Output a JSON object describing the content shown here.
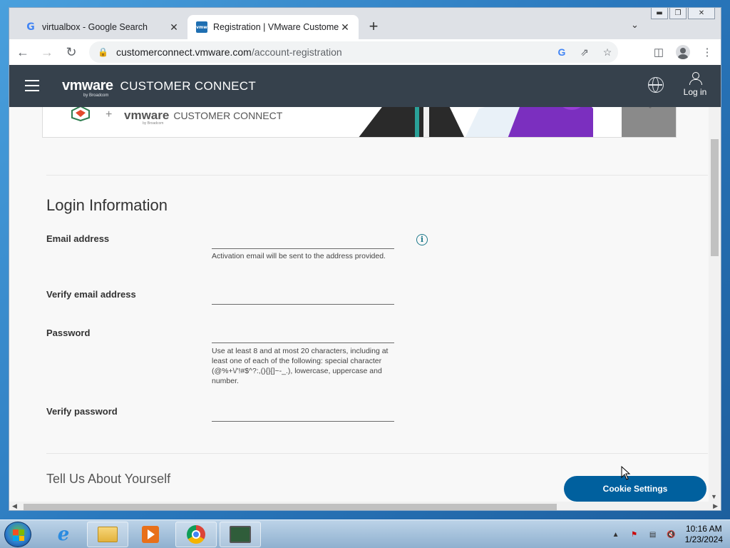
{
  "browser": {
    "tabs": [
      {
        "title": "virtualbox - Google Search",
        "active": false
      },
      {
        "title": "Registration | VMware Customer",
        "active": true
      }
    ],
    "url_host": "customerconnect.vmware.com",
    "url_path": "/account-registration"
  },
  "site": {
    "brand_logo": "vmware",
    "brand_by": "by Broadcom",
    "brand_name": "CUSTOMER CONNECT",
    "login_label": "Log in"
  },
  "banner": {
    "brand_logo": "vmware",
    "brand_name": "CUSTOMER CONNECT",
    "brand_by": "by Broadcom",
    "plus": "+"
  },
  "form": {
    "section_title": "Login Information",
    "email_label": "Email address",
    "email_value": "",
    "email_helper": "Activation email will be sent to the address provided.",
    "verify_email_label": "Verify email address",
    "verify_email_value": "",
    "password_label": "Password",
    "password_value": "",
    "password_helper": "Use at least 8 and at most 20 characters, including at least one of each of the following: special character (@%+\\/'!#$^?:,(){}[]~-_.), lowercase, uppercase and number.",
    "verify_password_label": "Verify password",
    "verify_password_value": "",
    "next_section_title": "Tell Us About Yourself"
  },
  "cookie_button": "Cookie Settings",
  "taskbar": {
    "time": "10:16 AM",
    "date": "1/23/2024"
  },
  "colors": {
    "header_bg": "#36414c",
    "cookie_button_bg": "#00609e",
    "info_icon": "#1f7a8c"
  }
}
